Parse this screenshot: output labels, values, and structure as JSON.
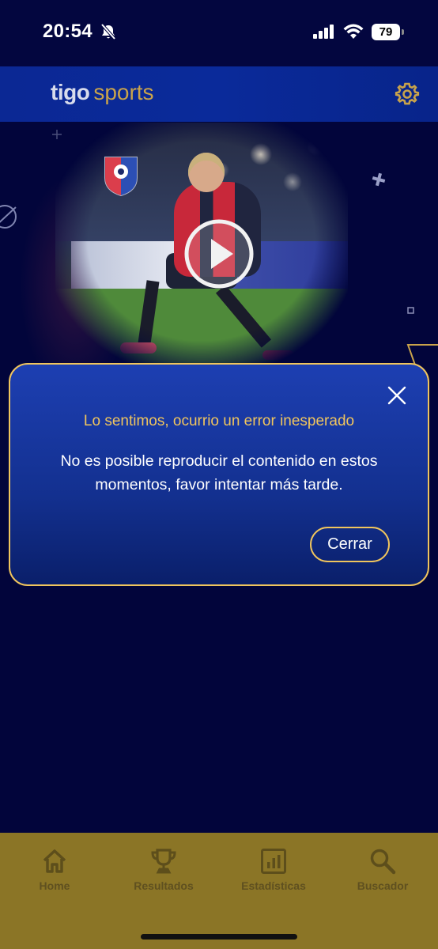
{
  "status_bar": {
    "time": "20:54",
    "battery": "79",
    "icons": [
      "bell-slash-icon",
      "cellular-signal-icon",
      "wifi-icon",
      "battery-icon"
    ]
  },
  "header": {
    "logo_part1": "tigo",
    "logo_part2": "sports",
    "settings_icon": "gear-icon"
  },
  "hero": {
    "play_icon": "play-icon",
    "badge_icon": "team-badge-icon"
  },
  "modal": {
    "title": "Lo sentimos, ocurrio un error inesperado",
    "message": "No es posible reproducir el contenido en estos momentos, favor intentar más tarde.",
    "close_icon": "close-icon",
    "button_label": "Cerrar"
  },
  "bottom_nav": {
    "items": [
      {
        "label": "Home",
        "icon": "home-icon"
      },
      {
        "label": "Resultados",
        "icon": "trophy-icon"
      },
      {
        "label": "Estadísticas",
        "icon": "bar-chart-icon"
      },
      {
        "label": "Buscador",
        "icon": "search-icon"
      }
    ]
  },
  "colors": {
    "background": "#02053b",
    "header": "#0b2894",
    "accent_gold": "#f0c55d",
    "nav_bg": "#8b7526"
  }
}
